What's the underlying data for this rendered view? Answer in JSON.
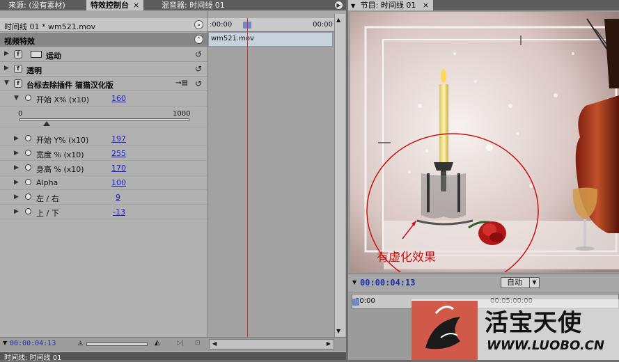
{
  "left_tabs": {
    "source": "来源: (没有素材)",
    "effect_controls": "特效控制台",
    "mixer": "混音器: 时间线 01",
    "close_glyph": "×"
  },
  "sequence": {
    "label": "时间线 01 * wm521.mov",
    "clip_name": "wm521.mov",
    "ruler_start": ":00:00",
    "ruler_end": "00:00"
  },
  "video_effects_header": "视频特效",
  "effects": [
    {
      "name": "运动"
    },
    {
      "name": "透明"
    },
    {
      "name": "台标去除插件 猫猫汉化版"
    }
  ],
  "params": [
    {
      "label": "开始 X% (x10)",
      "value": "160"
    },
    {
      "label": "开始 Y% (x10)",
      "value": "197"
    },
    {
      "label": "宽度 % (x10)",
      "value": "255"
    },
    {
      "label": "身高 % (x10)",
      "value": "170"
    },
    {
      "label": "Alpha",
      "value": "100"
    },
    {
      "label": "左 / 右",
      "value": "9"
    },
    {
      "label": "上 / 下",
      "value": "-13"
    }
  ],
  "slider": {
    "min": "0",
    "max": "1000",
    "value": 160
  },
  "left_footer": {
    "timecode": "00:00:04:13"
  },
  "bottom_tab": "时间线: 时间线 01",
  "program": {
    "tab": "节目: 时间线 01",
    "annotation": "有虚化效果",
    "timecode": "00:00:04:13",
    "zoom": "自动",
    "ruler_start": "00:00",
    "ruler_mid": "00:05:00:00"
  },
  "watermark": {
    "brand": "活宝天使",
    "url": "WWW.LUOBO.CN"
  },
  "colors": {
    "accent_timecode": "#1e2fb0",
    "value_link": "#1b1bc9",
    "playhead": "#d43030",
    "annotation_red": "#cc1111"
  }
}
